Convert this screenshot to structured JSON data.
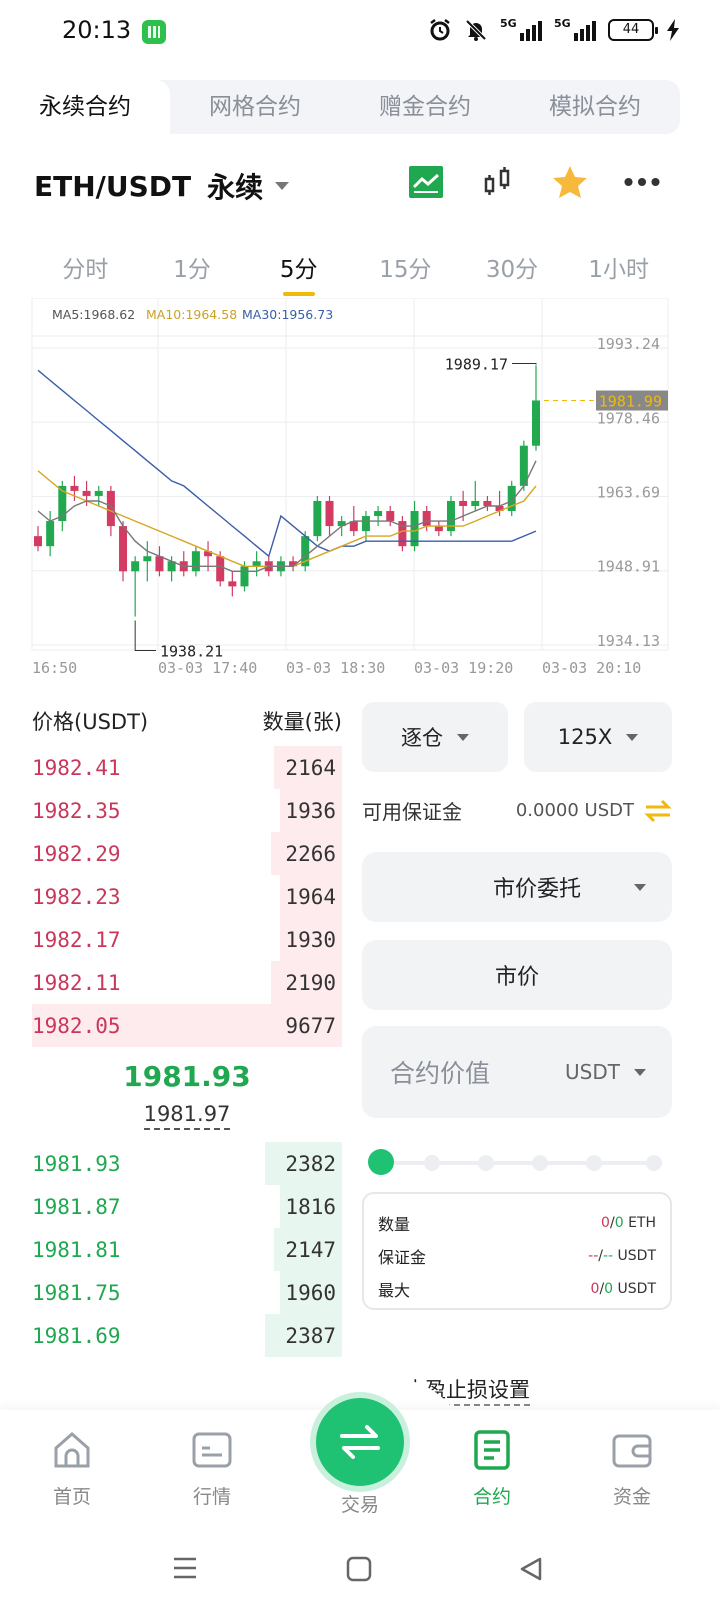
{
  "status_bar": {
    "time": "20:13",
    "network_1": "5G",
    "network_2": "5G",
    "battery": "44"
  },
  "top_tabs": [
    "永续合约",
    "网格合约",
    "赠金合约",
    "模拟合约"
  ],
  "pair": {
    "name": "ETH/USDT",
    "type": "永续"
  },
  "intervals": [
    "分时",
    "1分",
    "5分",
    "15分",
    "30分",
    "1小时"
  ],
  "chart_data": {
    "type": "candlestick",
    "ma_labels": {
      "ma5": "MA5:1968.62",
      "ma10": "MA10:1964.58",
      "ma30": "MA30:1956.73"
    },
    "y_ticks": [
      "1993.24",
      "1978.46",
      "1963.69",
      "1948.91",
      "1934.13"
    ],
    "current_price_tag": "1981.99",
    "high_label": "1989.17",
    "low_label": "1938.21",
    "x_ticks": [
      "16:50",
      "03-03  17:40",
      "03-03  18:30",
      "03-03  19:20",
      "03-03  20:10"
    ],
    "ylim": [
      1934.13,
      1993.24
    ],
    "candles": [
      [
        1955,
        1957,
        1952,
        1953
      ],
      [
        1953,
        1960,
        1951,
        1958
      ],
      [
        1958,
        1966,
        1956,
        1965
      ],
      [
        1965,
        1967,
        1962,
        1964
      ],
      [
        1964,
        1966,
        1961,
        1963
      ],
      [
        1963,
        1965,
        1961,
        1964
      ],
      [
        1964,
        1965,
        1955,
        1957
      ],
      [
        1957,
        1958,
        1946,
        1948
      ],
      [
        1948,
        1951,
        1939,
        1950
      ],
      [
        1950,
        1954,
        1946,
        1951
      ],
      [
        1951,
        1953,
        1947,
        1948
      ],
      [
        1948,
        1951,
        1946,
        1950
      ],
      [
        1950,
        1952,
        1947,
        1948
      ],
      [
        1948,
        1953,
        1947,
        1952
      ],
      [
        1952,
        1954,
        1948,
        1951
      ],
      [
        1951,
        1952,
        1945,
        1946
      ],
      [
        1946,
        1948,
        1943,
        1945
      ],
      [
        1945,
        1950,
        1944,
        1949
      ],
      [
        1949,
        1952,
        1947,
        1950
      ],
      [
        1950,
        1951,
        1947,
        1948
      ],
      [
        1948,
        1951,
        1947,
        1950
      ],
      [
        1950,
        1951,
        1948,
        1949
      ],
      [
        1949,
        1956,
        1948,
        1955
      ],
      [
        1955,
        1963,
        1954,
        1962
      ],
      [
        1962,
        1963,
        1955,
        1957
      ],
      [
        1957,
        1959,
        1955,
        1958
      ],
      [
        1958,
        1961,
        1955,
        1956
      ],
      [
        1956,
        1960,
        1954,
        1959
      ],
      [
        1959,
        1961,
        1957,
        1960
      ],
      [
        1960,
        1961,
        1957,
        1958
      ],
      [
        1958,
        1959,
        1952,
        1953
      ],
      [
        1953,
        1962,
        1952,
        1960
      ],
      [
        1960,
        1961,
        1956,
        1957
      ],
      [
        1957,
        1958,
        1955,
        1956
      ],
      [
        1956,
        1963,
        1955,
        1962
      ],
      [
        1962,
        1964,
        1958,
        1961
      ],
      [
        1961,
        1966,
        1960,
        1962
      ],
      [
        1962,
        1963,
        1960,
        1961
      ],
      [
        1961,
        1964,
        1959,
        1960
      ],
      [
        1960,
        1966,
        1959,
        1965
      ],
      [
        1965,
        1974,
        1964,
        1973
      ],
      [
        1973,
        1989,
        1972,
        1982
      ]
    ],
    "ma5": [
      1960,
      1958,
      1959,
      1961,
      1962,
      1962,
      1961,
      1957,
      1954,
      1952,
      1951,
      1950,
      1949,
      1949,
      1949,
      1949,
      1948,
      1948,
      1948,
      1949,
      1949,
      1949,
      1951,
      1953,
      1955,
      1957,
      1958,
      1958,
      1958,
      1958,
      1957,
      1957,
      1958,
      1958,
      1958,
      1959,
      1960,
      1961,
      1961,
      1962,
      1965,
      1970
    ],
    "ma10": [
      1968,
      1966,
      1964,
      1963,
      1962,
      1961,
      1960,
      1959,
      1958,
      1957,
      1956,
      1955,
      1954,
      1953,
      1952,
      1951,
      1950,
      1949,
      1949,
      1949,
      1949,
      1949,
      1950,
      1951,
      1952,
      1953,
      1954,
      1955,
      1955,
      1955,
      1956,
      1956,
      1957,
      1957,
      1957,
      1957,
      1958,
      1959,
      1960,
      1961,
      1962,
      1965
    ],
    "ma30": [
      1988,
      1986,
      1984,
      1982,
      1980,
      1978,
      1976,
      1974,
      1972,
      1970,
      1968,
      1966,
      1965,
      1963,
      1961,
      1959,
      1957,
      1955,
      1953,
      1951,
      1959,
      1957,
      1955,
      1953,
      1952,
      1953,
      1953,
      1954,
      1954,
      1954,
      1954,
      1954,
      1954,
      1954,
      1954,
      1954,
      1954,
      1954,
      1954,
      1954,
      1955,
      1956
    ]
  },
  "order_book": {
    "price_header": "价格(USDT)",
    "qty_header": "数量(张)",
    "asks": [
      {
        "price": "1982.41",
        "qty": "2164",
        "depth": 0.22
      },
      {
        "price": "1982.35",
        "qty": "1936",
        "depth": 0.2
      },
      {
        "price": "1982.29",
        "qty": "2266",
        "depth": 0.23
      },
      {
        "price": "1982.23",
        "qty": "1964",
        "depth": 0.2
      },
      {
        "price": "1982.17",
        "qty": "1930",
        "depth": 0.2
      },
      {
        "price": "1982.11",
        "qty": "2190",
        "depth": 0.23
      },
      {
        "price": "1982.05",
        "qty": "9677",
        "depth": 1.0
      }
    ],
    "last_price": "1981.93",
    "mark_price": "1981.97",
    "bids": [
      {
        "price": "1981.93",
        "qty": "2382",
        "depth": 0.25
      },
      {
        "price": "1981.87",
        "qty": "1816",
        "depth": 0.19
      },
      {
        "price": "1981.81",
        "qty": "2147",
        "depth": 0.22
      },
      {
        "price": "1981.75",
        "qty": "1960",
        "depth": 0.2
      },
      {
        "price": "1981.69",
        "qty": "2387",
        "depth": 0.25
      }
    ]
  },
  "trade_panel": {
    "margin_mode": "逐仓",
    "leverage": "125X",
    "available_label": "可用保证金",
    "available_value": "0.0000 USDT",
    "order_type": "市价委托",
    "price_field": "市价",
    "amount_placeholder": "合约价值",
    "amount_unit": "USDT",
    "info": {
      "qty_label": "数量",
      "qty_a": "0",
      "qty_sep": "/",
      "qty_b": "0",
      "qty_unit": "ETH",
      "margin_label": "保证金",
      "margin_a": "--",
      "margin_sep": "/",
      "margin_b": "--",
      "margin_unit": "USDT",
      "max_label": "最大",
      "max_a": "0",
      "max_sep": "/",
      "max_b": "0",
      "max_unit": "USDT"
    },
    "tpsl_label": "止盈止损设置"
  },
  "bottom_nav": [
    "首页",
    "行情",
    "交易",
    "合约",
    "资金"
  ]
}
